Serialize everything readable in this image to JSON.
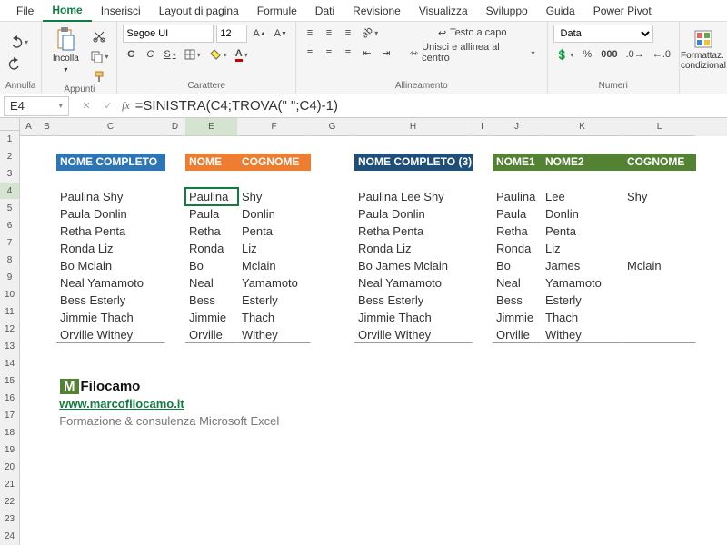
{
  "tabs": [
    "File",
    "Home",
    "Inserisci",
    "Layout di pagina",
    "Formule",
    "Dati",
    "Revisione",
    "Visualizza",
    "Sviluppo",
    "Guida",
    "Power Pivot"
  ],
  "active_tab": "Home",
  "ribbon": {
    "undo_group": "Annulla",
    "clipboard": {
      "paste": "Incolla",
      "group": "Appunti"
    },
    "font": {
      "name": "Segoe UI",
      "size": "12",
      "group": "Carattere",
      "bold": "G",
      "italic": "C",
      "underline": "S"
    },
    "align": {
      "wrap": "Testo a capo",
      "merge": "Unisci e allinea al centro",
      "group": "Allineamento"
    },
    "number": {
      "format": "Data",
      "group": "Numeri"
    },
    "styles": {
      "condfmt": "Formattaz. condizional"
    }
  },
  "namebox": "E4",
  "formula": "=SINISTRA(C4;TROVA(\" \";C4)-1)",
  "col_headers": [
    "A",
    "B",
    "C",
    "D",
    "E",
    "F",
    "G",
    "H",
    "I",
    "J",
    "K",
    "L"
  ],
  "headers": {
    "c": "NOME COMPLETO",
    "e": "NOME",
    "f": "COGNOME",
    "h": "NOME COMPLETO (3)",
    "j": "NOME1",
    "k": "NOME2",
    "l": "COGNOME"
  },
  "rows": [
    {
      "c": "Paulina Shy",
      "e": "Paulina",
      "f": "Shy",
      "h": "Paulina Lee Shy",
      "j": "Paulina",
      "k": "Lee",
      "l": "Shy"
    },
    {
      "c": "Paula Donlin",
      "e": "Paula",
      "f": "Donlin",
      "h": "Paula Donlin",
      "j": "Paula",
      "k": "Donlin",
      "l": ""
    },
    {
      "c": "Retha Penta",
      "e": "Retha",
      "f": "Penta",
      "h": "Retha Penta",
      "j": "Retha",
      "k": "Penta",
      "l": ""
    },
    {
      "c": "Ronda Liz",
      "e": "Ronda",
      "f": "Liz",
      "h": "Ronda Liz",
      "j": "Ronda",
      "k": "Liz",
      "l": ""
    },
    {
      "c": "Bo Mclain",
      "e": "Bo",
      "f": "Mclain",
      "h": "Bo James Mclain",
      "j": "Bo",
      "k": "James",
      "l": "Mclain"
    },
    {
      "c": "Neal Yamamoto",
      "e": "Neal",
      "f": "Yamamoto",
      "h": "Neal Yamamoto",
      "j": "Neal",
      "k": "Yamamoto",
      "l": ""
    },
    {
      "c": "Bess Esterly",
      "e": "Bess",
      "f": "Esterly",
      "h": "Bess Esterly",
      "j": "Bess",
      "k": "Esterly",
      "l": ""
    },
    {
      "c": "Jimmie Thach",
      "e": "Jimmie",
      "f": "Thach",
      "h": "Jimmie Thach",
      "j": "Jimmie",
      "k": "Thach",
      "l": ""
    },
    {
      "c": "Orville Withey",
      "e": "Orville",
      "f": "Withey",
      "h": "Orville Withey",
      "j": "Orville",
      "k": "Withey",
      "l": ""
    }
  ],
  "footer": {
    "brand": "Filocamo",
    "url": "www.marcofilocamo.it",
    "tagline": "Formazione & consulenza Microsoft Excel"
  }
}
